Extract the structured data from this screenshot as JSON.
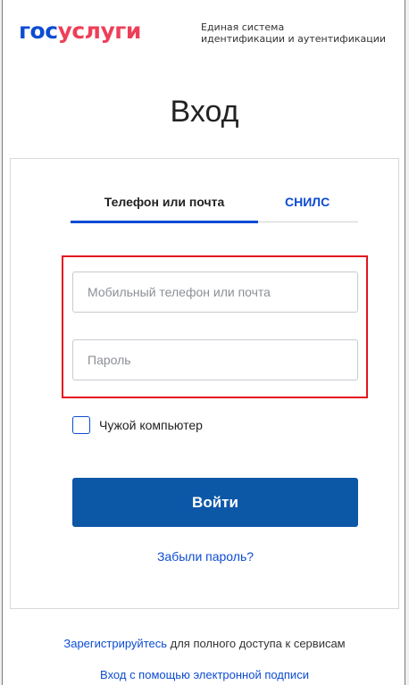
{
  "header": {
    "logo_part1": "гос",
    "logo_part2": "услуги",
    "tagline_line1": "Единая система",
    "tagline_line2": "идентификации и аутентификации"
  },
  "title": "Вход",
  "tabs": [
    {
      "label": "Телефон или почта",
      "active": true
    },
    {
      "label": "СНИЛС",
      "active": false
    }
  ],
  "form": {
    "login_placeholder": "Мобильный телефон или почта",
    "login_value": "",
    "password_placeholder": "Пароль",
    "password_value": "",
    "checkbox_label": "Чужой компьютер",
    "checkbox_checked": false,
    "submit_label": "Войти",
    "forgot_label": "Забыли пароль?"
  },
  "footer": {
    "register_link": "Зарегистрируйтесь",
    "register_text": " для полного доступа к сервисам",
    "signature_link": "Вход с помощью электронной подписи"
  },
  "colors": {
    "brand_blue": "#0d4cd3",
    "brand_red": "#ee3f58",
    "button_blue": "#0d57a7",
    "highlight_red": "#e4141f"
  }
}
